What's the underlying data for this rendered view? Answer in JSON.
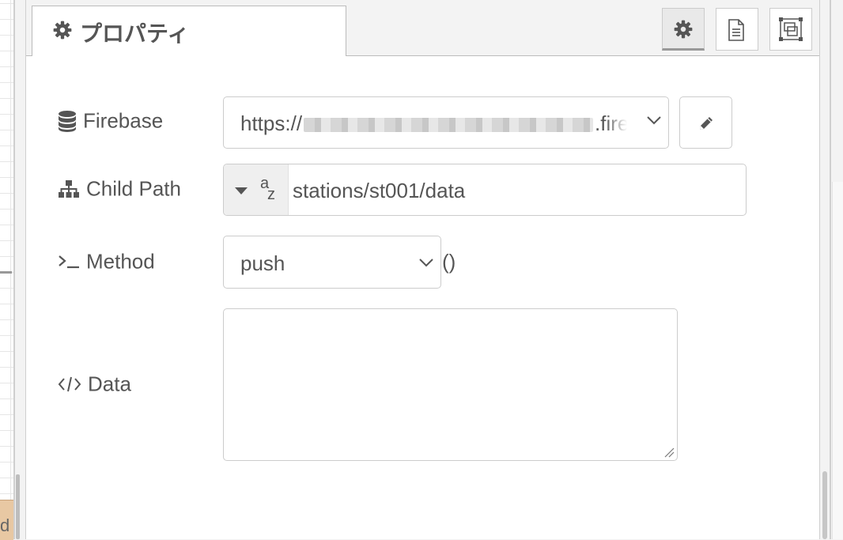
{
  "tray": {
    "tab_title": "プロパティ",
    "tab_icon": "gear-icon",
    "buttons": [
      {
        "name": "node-properties-button",
        "icon": "gear-icon",
        "active": true
      },
      {
        "name": "node-description-button",
        "icon": "document-icon",
        "active": false
      },
      {
        "name": "node-appearance-button",
        "icon": "frame-icon",
        "active": false
      }
    ]
  },
  "form": {
    "firebase": {
      "label": "Firebase",
      "icon": "database-icon",
      "value_prefix": "https://",
      "value_suffix": ".fire",
      "edit_icon": "pencil-icon"
    },
    "child_path": {
      "label": "Child Path",
      "icon": "sitemap-icon",
      "type_icon": "string-type-icon",
      "type_glyph_top": "a",
      "type_glyph_bottom": "z",
      "value": "stations/st001/data"
    },
    "method": {
      "label": "Method",
      "icon": "terminal-icon",
      "value": "push",
      "suffix": "()"
    },
    "data": {
      "label": "Data",
      "icon": "code-icon",
      "value": ""
    }
  },
  "workspace": {
    "node_label_fragment": "d"
  },
  "colors": {
    "text": "#555555",
    "border": "#cccccc",
    "node_fill": "#e8c8a3"
  }
}
